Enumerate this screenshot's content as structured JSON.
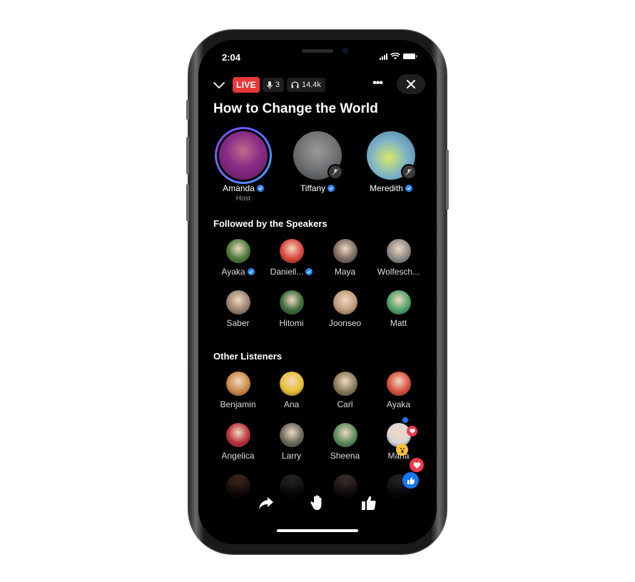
{
  "status_bar": {
    "time": "2:04"
  },
  "header": {
    "live_label": "LIVE",
    "speakers_count": "3",
    "listeners_count": "14.4k",
    "title": "How to Change the World"
  },
  "speakers": [
    {
      "name": "Amanda",
      "role": "Host",
      "verified": true,
      "muted": false,
      "avatar_color": "#8a2c86"
    },
    {
      "name": "Tiffany",
      "verified": true,
      "muted": true,
      "avatar_color": "#6b6e70"
    },
    {
      "name": "Meredith",
      "verified": true,
      "muted": true,
      "avatar_color": "#5aa3c4"
    }
  ],
  "followed_section": {
    "title": "Followed by the Speakers",
    "people": [
      {
        "name": "Ayaka",
        "verified": true,
        "avatar_color": "#4a7a3a"
      },
      {
        "name": "Daniell...",
        "verified": true,
        "avatar_color": "#d9453b"
      },
      {
        "name": "Maya",
        "verified": false,
        "avatar_color": "#7b6a5e"
      },
      {
        "name": "Wolfesch...",
        "verified": false,
        "avatar_color": "#8c8a86"
      },
      {
        "name": "Saber",
        "verified": false,
        "avatar_color": "#9b8470"
      },
      {
        "name": "Hitomi",
        "verified": false,
        "avatar_color": "#3c6b3a"
      },
      {
        "name": "Joonseo",
        "verified": false,
        "avatar_color": "#c09b7c"
      },
      {
        "name": "Matt",
        "verified": false,
        "avatar_color": "#4fa36a"
      }
    ]
  },
  "listeners_section": {
    "title": "Other Listeners",
    "people": [
      {
        "name": "Benjamin",
        "avatar_color": "#c98a4a"
      },
      {
        "name": "Ana",
        "avatar_color": "#e8c032"
      },
      {
        "name": "Carl",
        "avatar_color": "#8a7a5a"
      },
      {
        "name": "Ayaka",
        "avatar_color": "#d8503e"
      },
      {
        "name": "Angelica",
        "avatar_color": "#b8303a"
      },
      {
        "name": "Larry",
        "avatar_color": "#6a6a5a"
      },
      {
        "name": "Sheena",
        "avatar_color": "#5a8a5a"
      },
      {
        "name": "Maria",
        "avatar_color": "#d8d8d8"
      }
    ],
    "faded_row_colors": [
      "#6a3a2a",
      "#3a3a3a",
      "#6a4a4a",
      "#3a3a40"
    ]
  },
  "icons": {
    "collapse": "chevron-down-icon",
    "mic": "microphone-icon",
    "headphones": "headphones-icon",
    "more": "more-icon",
    "close": "close-icon",
    "share": "share-icon",
    "raise_hand": "raise-hand-icon",
    "like": "like-icon"
  },
  "colors": {
    "live": "#e8383b",
    "verified": "#2d88ff",
    "love": "#f0384b",
    "like": "#1877f2"
  }
}
